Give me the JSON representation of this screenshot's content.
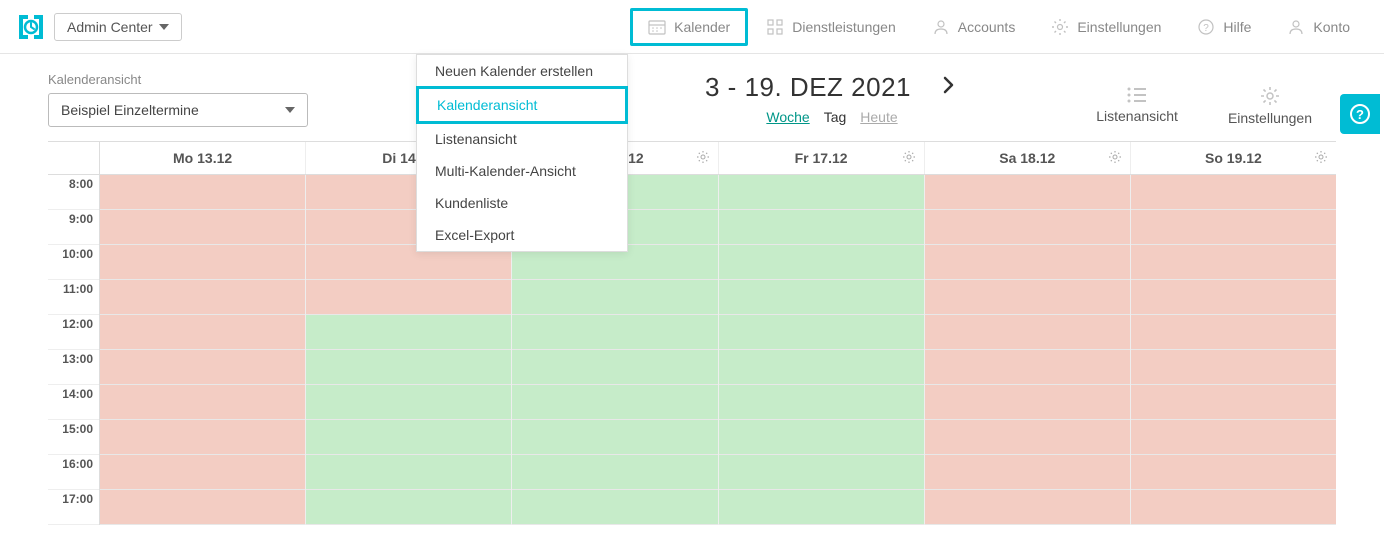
{
  "topbar": {
    "admin_center": "Admin Center",
    "nav": {
      "kalender": "Kalender",
      "dienstleistungen": "Dienstleistungen",
      "accounts": "Accounts",
      "einstellungen": "Einstellungen",
      "hilfe": "Hilfe",
      "konto": "Konto"
    }
  },
  "dropdown": {
    "item0": "Neuen Kalender erstellen",
    "item1": "Kalenderansicht",
    "item2": "Listenansicht",
    "item3": "Multi-Kalender-Ansicht",
    "item4": "Kundenliste",
    "item5": "Excel-Export"
  },
  "sidebar": {
    "label": "Kalenderansicht",
    "selected": "Beispiel Einzeltermine"
  },
  "header": {
    "date_title": "3 - 19. DEZ 2021",
    "views": {
      "woche": "Woche",
      "tag": "Tag",
      "heute": "Heute"
    }
  },
  "right_actions": {
    "listenansicht": "Listenansicht",
    "einstellungen": "Einstellungen"
  },
  "days": {
    "d0": "Mo 13.12",
    "d1": "Di 14.12",
    "d2": "Do 16.12",
    "d3": "Fr 17.12",
    "d4": "Sa 18.12",
    "d5": "So 19.12"
  },
  "times": {
    "t0": "8:00",
    "t1": "9:00",
    "t2": "10:00",
    "t3": "11:00",
    "t4": "12:00",
    "t5": "13:00",
    "t6": "14:00",
    "t7": "15:00",
    "t8": "16:00",
    "t9": "17:00"
  },
  "availability": {
    "d0": [
      "busy",
      "busy",
      "busy",
      "busy",
      "busy",
      "busy",
      "busy",
      "busy",
      "busy",
      "busy"
    ],
    "d1": [
      "busy",
      "busy",
      "busy",
      "busy",
      "free",
      "free",
      "free",
      "free",
      "free",
      "free"
    ],
    "d2": [
      "free",
      "free",
      "free",
      "free",
      "free",
      "free",
      "free",
      "free",
      "free",
      "free"
    ],
    "d3": [
      "free",
      "free",
      "free",
      "free",
      "free",
      "free",
      "free",
      "free",
      "free",
      "free"
    ],
    "d4": [
      "busy",
      "busy",
      "busy",
      "busy",
      "busy",
      "busy",
      "busy",
      "busy",
      "busy",
      "busy"
    ],
    "d5": [
      "busy",
      "busy",
      "busy",
      "busy",
      "busy",
      "busy",
      "busy",
      "busy",
      "busy",
      "busy"
    ]
  }
}
